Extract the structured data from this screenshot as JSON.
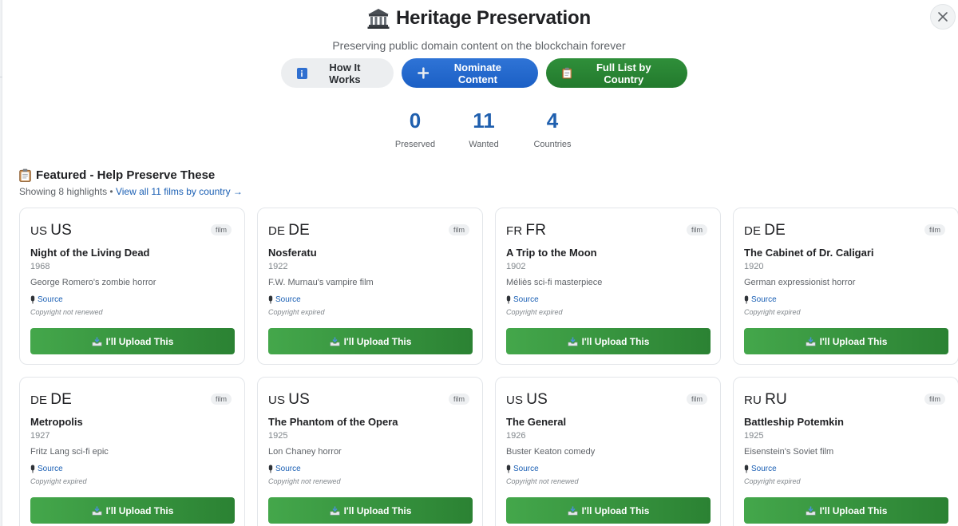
{
  "header": {
    "title": "Heritage Preservation",
    "subtitle": "Preserving public domain content on the blockchain forever"
  },
  "actions": {
    "how_it_works": "How It Works",
    "nominate": "Nominate Content",
    "full_list": "Full List by Country"
  },
  "stats": [
    {
      "value": "0",
      "label": "Preserved"
    },
    {
      "value": "11",
      "label": "Wanted"
    },
    {
      "value": "4",
      "label": "Countries"
    }
  ],
  "featured": {
    "title": "Featured - Help Preserve These",
    "showing": "Showing 8 highlights",
    "separator": " • ",
    "view_all": "View all 11 films by country →"
  },
  "cards": [
    {
      "code": "US",
      "country": "US",
      "type": "film",
      "title": "Night of the Living Dead",
      "year": "1968",
      "description": "George Romero's zombie horror",
      "source": "Source",
      "status": "Copyright not renewed",
      "upload": "I'll Upload This"
    },
    {
      "code": "DE",
      "country": "DE",
      "type": "film",
      "title": "Nosferatu",
      "year": "1922",
      "description": "F.W. Murnau's vampire film",
      "source": "Source",
      "status": "Copyright expired",
      "upload": "I'll Upload This"
    },
    {
      "code": "FR",
      "country": "FR",
      "type": "film",
      "title": "A Trip to the Moon",
      "year": "1902",
      "description": "Méliès sci-fi masterpiece",
      "source": "Source",
      "status": "Copyright expired",
      "upload": "I'll Upload This"
    },
    {
      "code": "DE",
      "country": "DE",
      "type": "film",
      "title": "The Cabinet of Dr. Caligari",
      "year": "1920",
      "description": "German expressionist horror",
      "source": "Source",
      "status": "Copyright expired",
      "upload": "I'll Upload This"
    },
    {
      "code": "DE",
      "country": "DE",
      "type": "film",
      "title": "Metropolis",
      "year": "1927",
      "description": "Fritz Lang sci-fi epic",
      "source": "Source",
      "status": "Copyright expired",
      "upload": "I'll Upload This"
    },
    {
      "code": "US",
      "country": "US",
      "type": "film",
      "title": "The Phantom of the Opera",
      "year": "1925",
      "description": "Lon Chaney horror",
      "source": "Source",
      "status": "Copyright not renewed",
      "upload": "I'll Upload This"
    },
    {
      "code": "US",
      "country": "US",
      "type": "film",
      "title": "The General",
      "year": "1926",
      "description": "Buster Keaton comedy",
      "source": "Source",
      "status": "Copyright not renewed",
      "upload": "I'll Upload This"
    },
    {
      "code": "RU",
      "country": "RU",
      "type": "film",
      "title": "Battleship Potemkin",
      "year": "1925",
      "description": "Eisenstein's Soviet film",
      "source": "Source",
      "status": "Copyright expired",
      "upload": "I'll Upload This"
    }
  ],
  "icons": {
    "title": "classical-building-icon",
    "how_it_works": "info-icon",
    "nominate": "plus-icon",
    "full_list": "clipboard-icon",
    "featured": "clipboard-icon",
    "source": "microphone-icon",
    "upload": "inbox-tray-icon",
    "close": "close-icon"
  },
  "colors": {
    "accent_blue": "#1b5fc5",
    "accent_green": "#2b8233",
    "stat_blue": "#1f5fae",
    "link_blue": "#1a5fb4"
  }
}
